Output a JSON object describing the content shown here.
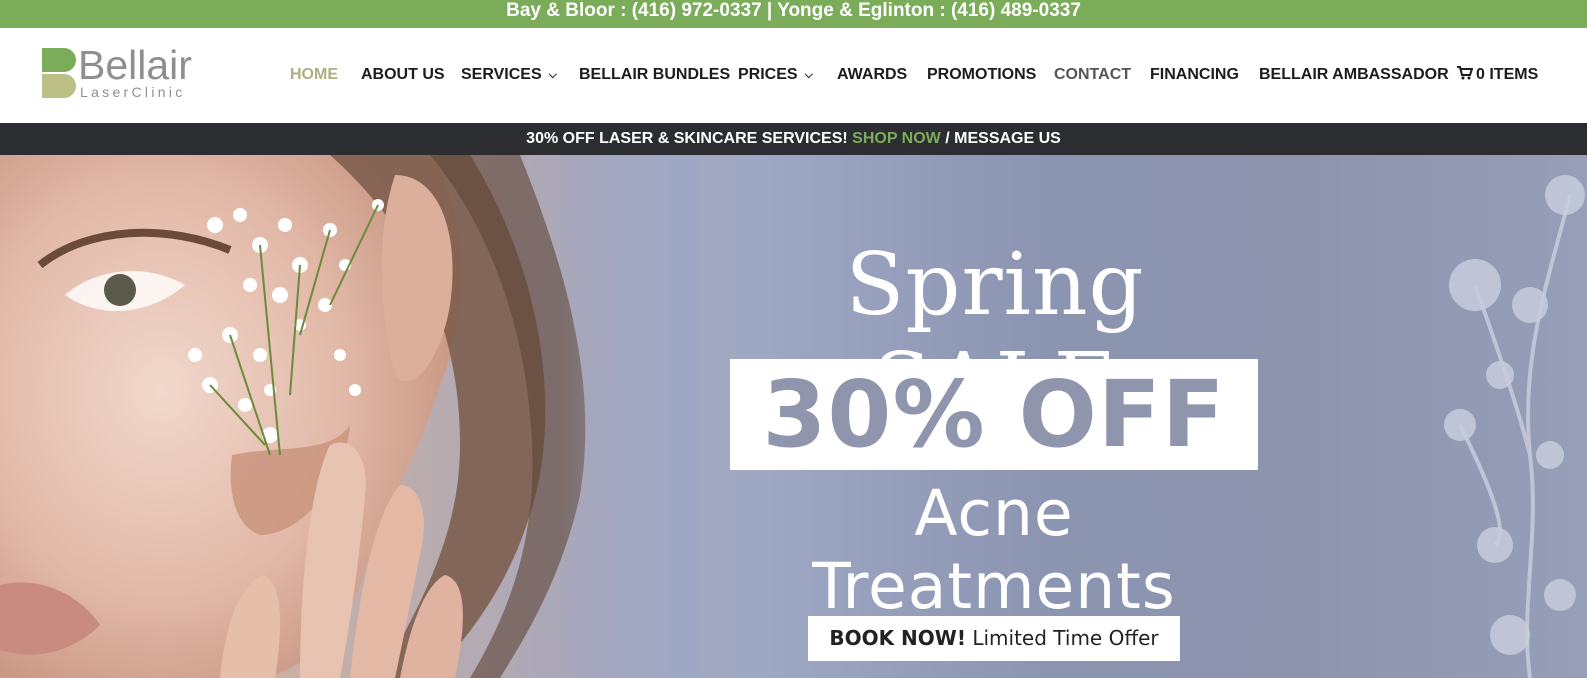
{
  "topbar": {
    "text": "Bay & Bloor : (416) 972-0337 | Yonge & Eglinton : (416) 489-0337",
    "color": "#7aac59"
  },
  "logo": {
    "name": "Bellair",
    "sub": "LaserClinic"
  },
  "nav": {
    "items": [
      {
        "label": "HOME",
        "active": true
      },
      {
        "label": "ABOUT US"
      },
      {
        "label": "SERVICES",
        "has_dropdown": true
      },
      {
        "label": "BELLAIR BUNDLES"
      },
      {
        "label": "PRICES",
        "has_dropdown": true
      },
      {
        "label": "AWARDS"
      },
      {
        "label": "PROMOTIONS"
      },
      {
        "label": "CONTACT"
      },
      {
        "label": "FINANCING"
      },
      {
        "label": "BELLAIR AMBASSADOR"
      }
    ],
    "cart_label": "0 ITEMS",
    "cart_icon": "cart-icon"
  },
  "promo": {
    "text": "30% OFF LASER & SKINCARE SERVICES!",
    "shop_now": "SHOP NOW",
    "separator": "/",
    "message": "MESSAGE US"
  },
  "hero": {
    "title": "Spring SALE",
    "offer": "30% OFF",
    "subtitle": "Acne Treatments",
    "button_bold": "BOOK NOW!",
    "button_rest": "Limited Time Offer"
  },
  "colors": {
    "brand_green": "#7aac59",
    "active_nav": "#b0ad82",
    "promo_bg": "#2b2d31",
    "hero_offer": "#8e95ad"
  }
}
